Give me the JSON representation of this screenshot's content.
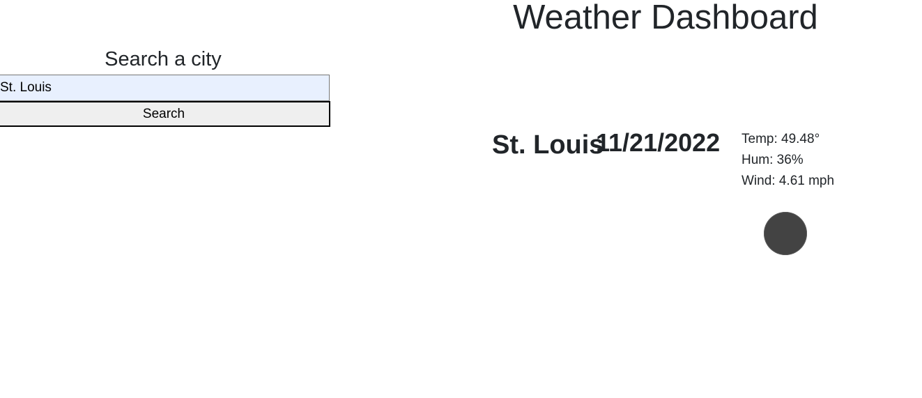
{
  "header": {
    "title": "Weather Dashboard"
  },
  "search": {
    "heading": "Search a city",
    "input_value": "St. Louis",
    "button_label": "Search"
  },
  "current": {
    "city": "St. Louis",
    "date": "11/21/2022",
    "temp": "Temp: 49.48°",
    "humidity": "Hum: 36%",
    "wind": "Wind: 4.61 mph",
    "icon": "weather-icon"
  },
  "colors": {
    "input_autofill_bg": "#e8f0fe",
    "button_bg": "#efefef",
    "icon_fill": "#434343",
    "text": "#212529"
  }
}
